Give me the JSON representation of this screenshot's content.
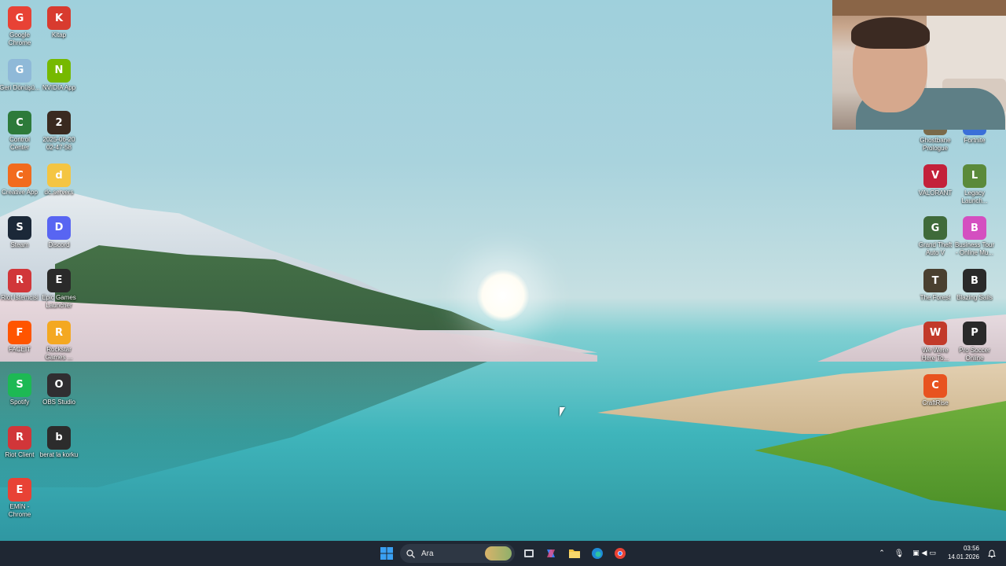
{
  "desktop_icons_left": [
    {
      "label": "Google Chrome",
      "icon": "chrome-icon",
      "color": "#e84235"
    },
    {
      "label": "Kitap",
      "icon": "pdf-icon",
      "color": "#d83b2f"
    },
    {
      "label": "Geri Dönüşü...",
      "icon": "recycle-bin-icon",
      "color": "#8fb9d8"
    },
    {
      "label": "NVIDIA App",
      "icon": "nvidia-icon",
      "color": "#76b900"
    },
    {
      "label": "Control Center",
      "icon": "control-center-icon",
      "color": "#2d7a3a"
    },
    {
      "label": "2025-06-20 02-47-58",
      "icon": "video-file-icon",
      "color": "#3a2a20"
    },
    {
      "label": "Creative App",
      "icon": "creative-app-icon",
      "color": "#f26b1d"
    },
    {
      "label": "dc.servers",
      "icon": "folder-icon",
      "color": "#f4c542"
    },
    {
      "label": "Steam",
      "icon": "steam-icon",
      "color": "#1b2838"
    },
    {
      "label": "Discord",
      "icon": "discord-icon",
      "color": "#5865f2"
    },
    {
      "label": "Riot İstemcisi",
      "icon": "riot-icon",
      "color": "#d13639"
    },
    {
      "label": "Epic Games Launcher",
      "icon": "epic-icon",
      "color": "#2a2a2a"
    },
    {
      "label": "FACEIT",
      "icon": "faceit-icon",
      "color": "#ff5500"
    },
    {
      "label": "Rockstar Games ...",
      "icon": "rockstar-icon",
      "color": "#f4a821"
    },
    {
      "label": "Spotify",
      "icon": "spotify-icon",
      "color": "#1db954"
    },
    {
      "label": "OBS Studio",
      "icon": "obs-icon",
      "color": "#302e31"
    },
    {
      "label": "Riot Client",
      "icon": "riot-client-icon",
      "color": "#d13639"
    },
    {
      "label": "berat la korku",
      "icon": "video-file-icon",
      "color": "#2c2c2c"
    },
    {
      "label": "EMİN - Chrome",
      "icon": "chrome-profile-icon",
      "color": "#e84235"
    }
  ],
  "desktop_icons_right": [
    {
      "label": "Ghostbane Prologue",
      "icon": "game-icon",
      "color": "#7a6a4a"
    },
    {
      "label": "Fortnite",
      "icon": "fortnite-icon",
      "color": "#3a6fd8"
    },
    {
      "label": "VALORANT",
      "icon": "valorant-icon",
      "color": "#c3213a"
    },
    {
      "label": "Legacy Launch...",
      "icon": "minecraft-icon",
      "color": "#5b8a3a"
    },
    {
      "label": "Grand Theft Auto V",
      "icon": "gta-icon",
      "color": "#3f6a3a"
    },
    {
      "label": "Business Tour - Online Mu...",
      "icon": "business-tour-icon",
      "color": "#d44fc0"
    },
    {
      "label": "The Forest",
      "icon": "the-forest-icon",
      "color": "#4a4030"
    },
    {
      "label": "Blazing Sails",
      "icon": "epic-icon",
      "color": "#2a2a2a"
    },
    {
      "label": "We Were Here To...",
      "icon": "walkie-talkie-icon",
      "color": "#c23a2a"
    },
    {
      "label": "Pro Soccer Online",
      "icon": "soccer-icon",
      "color": "#2a2a2a"
    },
    {
      "label": "CraftRise",
      "icon": "craftrise-icon",
      "color": "#e8531f"
    }
  ],
  "taskbar": {
    "search_label": "Ara",
    "time": "03:56",
    "date": "14.01.2026",
    "apps": [
      "start-icon",
      "task-view-icon",
      "copilot-icon",
      "file-explorer-icon",
      "edge-icon",
      "chrome-icon"
    ]
  }
}
